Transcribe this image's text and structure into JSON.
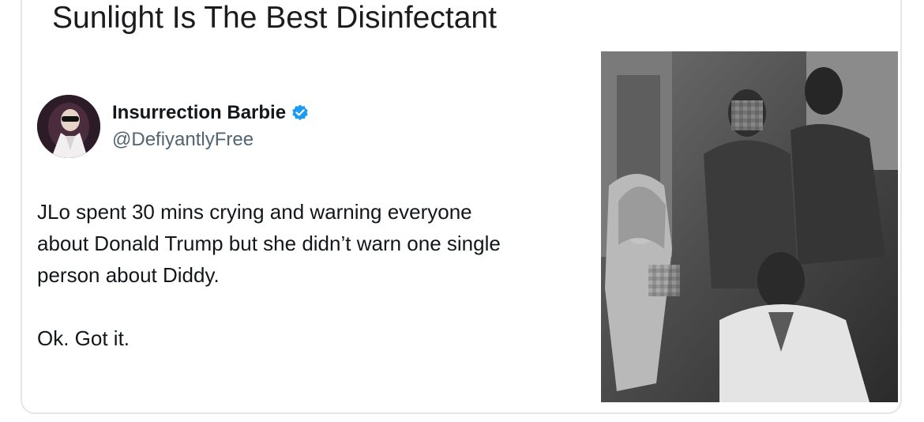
{
  "post": {
    "title": "Sunlight Is The Best Disinfectant"
  },
  "tweet": {
    "author_name": "Insurrection Barbie",
    "author_handle": "@DefiyantlyFree",
    "verified_icon": "verified-badge-icon",
    "text_lines": [
      "JLo spent 30 mins crying and warning everyone",
      "about Donald Trump but she didn’t warn one single",
      "person about Diddy.",
      "Ok. Got it."
    ]
  },
  "colors": {
    "verified_blue": "#1d9bf0",
    "handle_gray": "#536471",
    "text_dark": "#14171a",
    "card_border": "#e6e6e9"
  }
}
